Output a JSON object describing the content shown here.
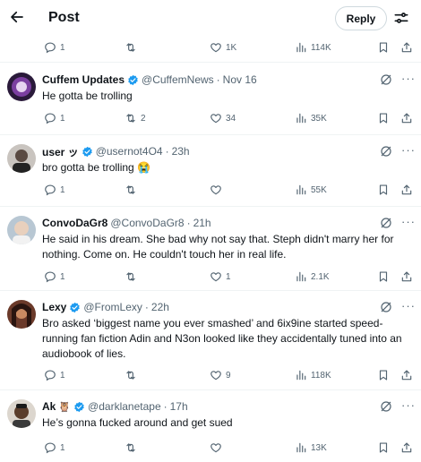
{
  "header": {
    "title": "Post",
    "reply_label": "Reply"
  },
  "top_actions": {
    "replies": "1",
    "retweets": "",
    "likes": "1K",
    "views": "114K"
  },
  "tweets": [
    {
      "name": "Cuffem Updates",
      "emoji": "",
      "handle": "@CuffemNews",
      "time": "Nov 16",
      "text": "He gotta be trolling",
      "replies": "1",
      "retweets": "2",
      "likes": "34",
      "views": "35K"
    },
    {
      "name": "user ッ",
      "emoji": "",
      "handle": "@usernot4O4",
      "time": "23h",
      "text": "bro gotta be trolling 😭",
      "replies": "1",
      "retweets": "",
      "likes": "",
      "views": "55K"
    },
    {
      "name": "ConvoDaGr8",
      "emoji": "",
      "handle": "@ConvoDaGr8",
      "time": "21h",
      "text": "He said in his dream. She bad why not say that. Steph didn't marry her for nothing. Come on. He couldn't touch her in real life.",
      "replies": "1",
      "retweets": "",
      "likes": "1",
      "views": "2.1K"
    },
    {
      "name": "Lexy",
      "emoji": "",
      "handle": "@FromLexy",
      "time": "22h",
      "text": "Bro asked ‘biggest name you ever smashed’ and 6ix9ine started speed-running fan fiction Adin and N3on looked like they accidentally tuned into an audiobook of lies.",
      "replies": "1",
      "retweets": "",
      "likes": "9",
      "views": "118K"
    },
    {
      "name": "Ak",
      "emoji": "🦉",
      "handle": "@darklanetape",
      "time": "17h",
      "text": "He’s gonna fucked around and get sued",
      "replies": "1",
      "retweets": "",
      "likes": "",
      "views": "13K"
    }
  ],
  "colors": {
    "text": "#0f1419",
    "muted": "#536471",
    "verified": "#1d9bf0",
    "border": "#eff3f4"
  }
}
